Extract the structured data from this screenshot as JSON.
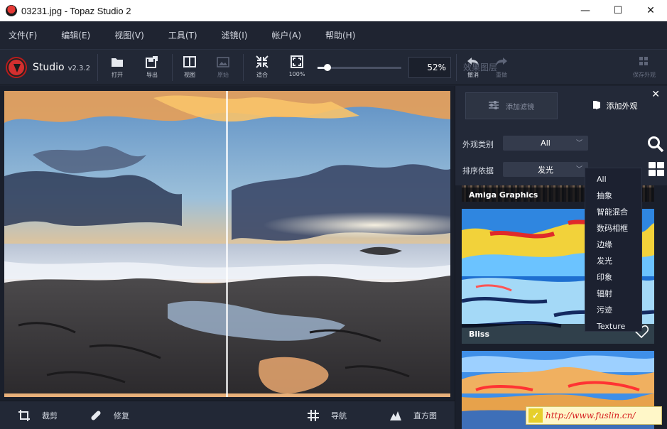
{
  "window": {
    "title": "03231.jpg - Topaz Studio 2",
    "minimize": "—",
    "maximize": "☐",
    "close": "✕"
  },
  "menu": [
    "文件(F)",
    "编辑(E)",
    "视图(V)",
    "工具(T)",
    "滤镜(I)",
    "帐户(A)",
    "帮助(H)"
  ],
  "brand": {
    "name": "Studio",
    "version": "v2.3.2"
  },
  "toolbar": {
    "open": "打开",
    "export": "导出",
    "view": "视图",
    "original": "原始",
    "fit": "适合",
    "zoom100": "100%",
    "zoom_value": "52%",
    "zoom_level": 0.12,
    "undo": "撤消",
    "redo": "重做",
    "faded_label": "效果图层",
    "save_look": "保存外观"
  },
  "bottom": {
    "crop": "裁剪",
    "repair": "修复",
    "navigate": "导航",
    "histogram": "直方图"
  },
  "panel": {
    "add_filter": "添加滤镜",
    "add_look": "添加外观",
    "close": "✕",
    "category_label": "外观类别",
    "category_value": "All",
    "sort_label": "排序依据",
    "sort_value": "发光"
  },
  "looks": [
    {
      "name": "Amiga Graphics"
    },
    {
      "name": "Bliss"
    },
    {
      "name": ""
    }
  ],
  "sort_options": [
    "All",
    "抽象",
    "智能混合",
    "数码相框",
    "边缘",
    "发光",
    "印象",
    "辐射",
    "污迹",
    "Texture"
  ],
  "watermark": "http://www.fuslin.cn/",
  "colors": {
    "accent": "#e53935",
    "panel": "#232938",
    "background": "#1e2330"
  }
}
